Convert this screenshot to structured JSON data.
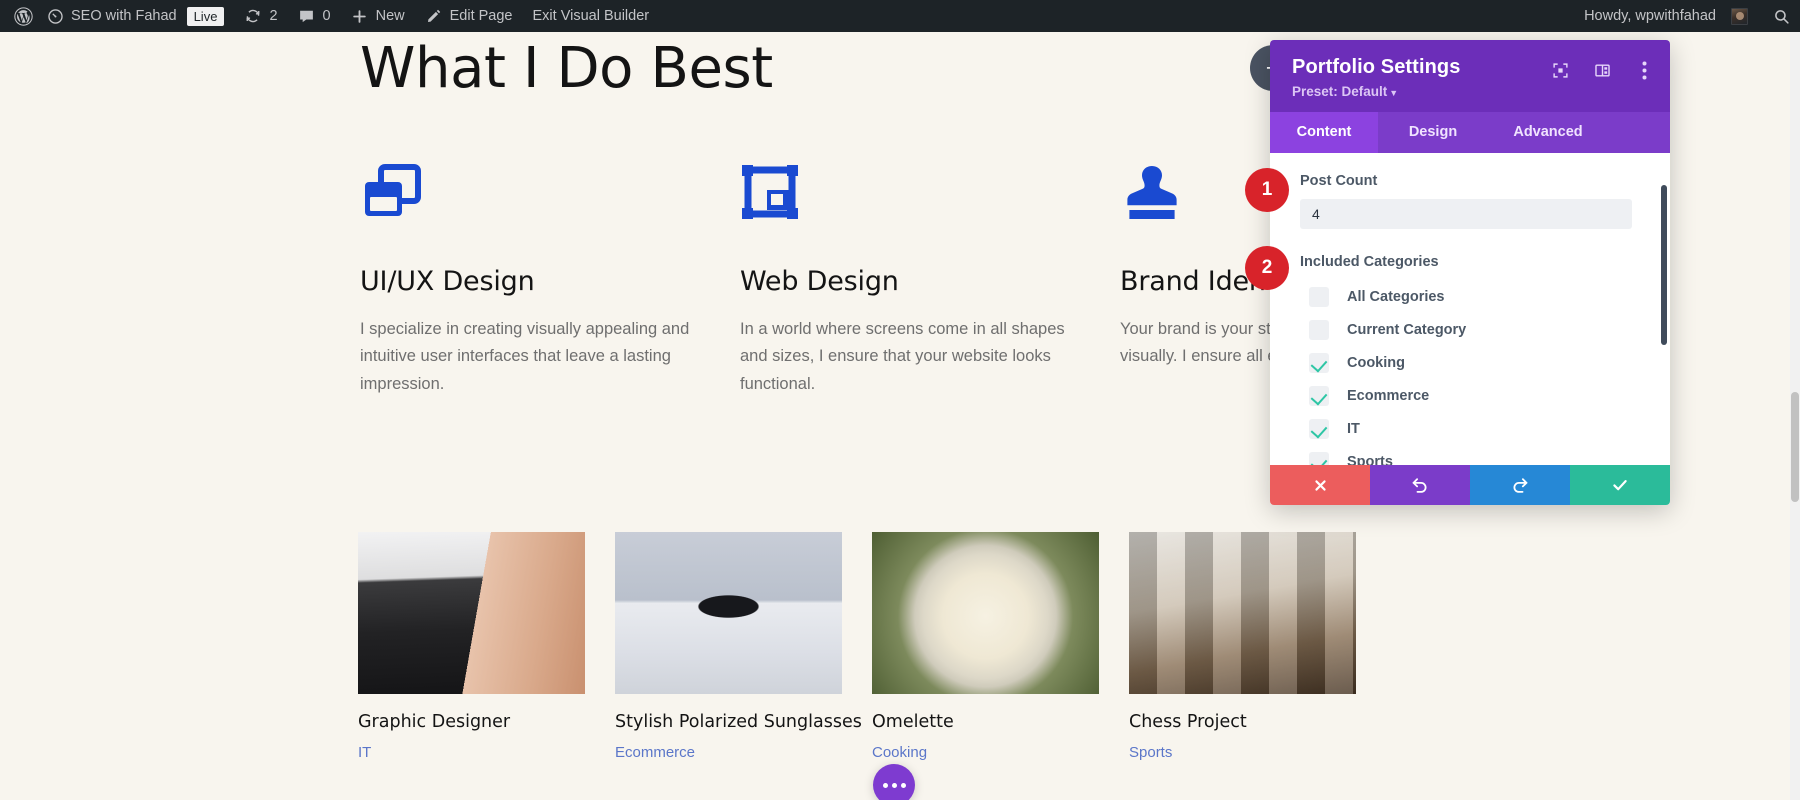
{
  "adminbar": {
    "wp_logo": "wordpress-logo-icon",
    "site_name": "SEO with Fahad",
    "live_badge": "Live",
    "updates_icon": "updates-icon",
    "updates_count": "2",
    "comments_icon": "comments-icon",
    "comments_count": "0",
    "new_icon": "plus-icon",
    "new_label": "New",
    "edit_icon": "pencil-icon",
    "edit_label": "Edit Page",
    "exit_label": "Exit Visual Builder",
    "howdy": "Howdy, wpwithfahad",
    "avatar": "user-avatar",
    "search_icon": "search-icon"
  },
  "content": {
    "headline": "What I Do Best",
    "services": [
      {
        "icon": "windows-layers-icon",
        "title": "UI/UX Design",
        "body": "I specialize in creating visually appealing and intuitive user interfaces that leave a lasting impression."
      },
      {
        "icon": "crop-frame-icon",
        "title": "Web Design",
        "body": "In a world where screens come in all shapes and sizes, I ensure that your website looks functional."
      },
      {
        "icon": "stamp-icon",
        "title": "Brand Identity",
        "body": "Your brand is your story, and I help you tell it visually. I ensure all elements are aligned."
      }
    ],
    "portfolio": [
      {
        "thumb": "laptop-hands-photo",
        "title": "Graphic Designer",
        "category": "IT"
      },
      {
        "thumb": "sunglasses-photo",
        "title": "Stylish Polarized Sunglasses",
        "category": "Ecommerce"
      },
      {
        "thumb": "omelette-plate-photo",
        "title": "Omelette",
        "category": "Cooking"
      },
      {
        "thumb": "chess-board-photo",
        "title": "Chess Project",
        "category": "Sports"
      }
    ],
    "fab_icon": "more-options-icon",
    "add_module_label": "+"
  },
  "modal": {
    "title": "Portfolio Settings",
    "preset_label": "Preset: Default",
    "header_icons": [
      "focus-target-icon",
      "panel-layout-icon",
      "vertical-dots-icon"
    ],
    "tabs": [
      {
        "label": "Content",
        "active": true
      },
      {
        "label": "Design",
        "active": false
      },
      {
        "label": "Advanced",
        "active": false
      }
    ],
    "post_count": {
      "label": "Post Count",
      "value": "4",
      "placeholder": "4"
    },
    "included_categories": {
      "label": "Included Categories",
      "options": [
        {
          "label": "All Categories",
          "checked": false
        },
        {
          "label": "Current Category",
          "checked": false
        },
        {
          "label": "Cooking",
          "checked": true
        },
        {
          "label": "Ecommerce",
          "checked": true
        },
        {
          "label": "IT",
          "checked": true
        },
        {
          "label": "Sports",
          "checked": true
        }
      ]
    },
    "footer": [
      {
        "name": "cancel-button",
        "icon": "close-x-icon",
        "color": "#ec5d5d"
      },
      {
        "name": "undo-button",
        "icon": "undo-icon",
        "color": "#7b3cc9"
      },
      {
        "name": "redo-button",
        "icon": "redo-icon",
        "color": "#2688d6"
      },
      {
        "name": "save-button",
        "icon": "checkmark-icon",
        "color": "#2bbb9a"
      }
    ]
  },
  "markers": [
    {
      "number": "1",
      "target": "post-count-field"
    },
    {
      "number": "2",
      "target": "included-categories-field"
    }
  ],
  "colors": {
    "divi_purple": "#6c2eb9",
    "tab_active": "#8c42e0",
    "accent_blue": "#1a4ad1",
    "link_blue": "#5b76c9",
    "check_teal": "#2ec6a5",
    "marker_red": "#d8232a",
    "page_bg": "#f8f5ee",
    "adminbar_bg": "#1d2327"
  }
}
